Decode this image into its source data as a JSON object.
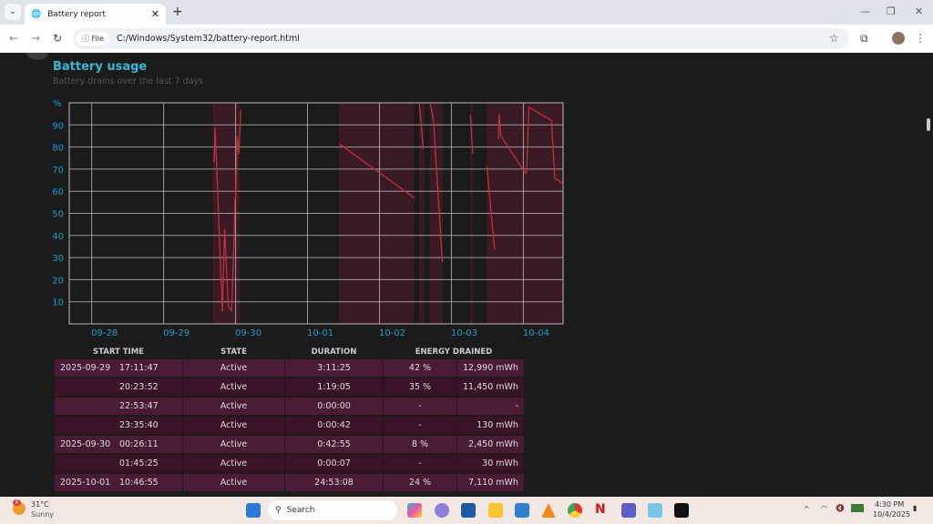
{
  "browser": {
    "tab_title": "Battery report",
    "file_chip": "File",
    "url": "C:/Windows/System32/battery-report.html"
  },
  "section": {
    "title": "Battery usage",
    "subtitle": "Battery drains over the last 7 days"
  },
  "chart_data": {
    "type": "line",
    "ylabel": "%",
    "ylim": [
      0,
      100
    ],
    "yticks": [
      10,
      20,
      30,
      40,
      50,
      60,
      70,
      80,
      90
    ],
    "xlim": [
      "2025-09-27T16:30",
      "2025-10-04T13:15"
    ],
    "xticks": [
      {
        "label": "09-28",
        "t": "2025-09-28T00:00"
      },
      {
        "label": "09-29",
        "t": "2025-09-29T00:00"
      },
      {
        "label": "09-30",
        "t": "2025-09-30T00:00"
      },
      {
        "label": "10-01",
        "t": "2025-10-01T00:00"
      },
      {
        "label": "10-02",
        "t": "2025-10-02T00:00"
      },
      {
        "label": "10-03",
        "t": "2025-10-03T00:00"
      },
      {
        "label": "10-04",
        "t": "2025-10-04T00:00"
      }
    ],
    "grid": true,
    "line_color": "#c0303e",
    "shade_color": "#3a1a24",
    "active_periods": [
      [
        "2025-09-29T16:19",
        "2025-09-30T01:26"
      ],
      [
        "2025-10-01T10:34",
        "2025-10-02T11:31"
      ],
      [
        "2025-10-02T13:12",
        "2025-10-02T14:53"
      ],
      [
        "2025-10-02T16:48",
        "2025-10-02T21:07"
      ],
      [
        "2025-10-03T06:14",
        "2025-10-03T07:12"
      ],
      [
        "2025-10-03T11:46",
        "2025-10-04T13:12"
      ]
    ],
    "series": [
      {
        "points": [
          [
            "2025-09-29T16:50",
            73
          ],
          [
            "2025-09-29T17:10",
            89
          ],
          [
            "2025-09-29T19:35",
            5.5
          ],
          [
            "2025-09-29T20:21",
            43
          ],
          [
            "2025-09-29T21:34",
            7.5
          ],
          [
            "2025-09-29T22:41",
            6
          ],
          [
            "2025-09-29T23:32",
            41
          ],
          [
            "2025-09-29T23:50",
            57
          ]
        ]
      },
      {
        "points": [
          [
            "2025-09-30T00:00",
            57
          ],
          [
            "2025-09-30T00:33",
            85
          ],
          [
            "2025-09-30T01:06",
            77
          ],
          [
            "2025-09-30T01:46",
            97
          ]
        ]
      },
      {
        "points": [
          [
            "2025-10-01T10:32",
            81.5
          ],
          [
            "2025-10-02T11:35",
            57
          ]
        ]
      },
      {
        "points": [
          [
            "2025-10-02T13:15",
            100
          ],
          [
            "2025-10-02T14:38",
            79
          ]
        ]
      },
      {
        "points": [
          [
            "2025-10-02T16:52",
            100
          ],
          [
            "2025-10-02T17:59",
            92.5
          ],
          [
            "2025-10-02T20:58",
            28
          ]
        ]
      },
      {
        "points": [
          [
            "2025-10-03T06:20",
            94.5
          ],
          [
            "2025-10-03T07:07",
            77
          ]
        ]
      },
      {
        "points": [
          [
            "2025-10-03T11:51",
            71
          ],
          [
            "2025-10-03T14:24",
            33.5
          ]
        ]
      },
      {
        "points": [
          [
            "2025-10-03T15:43",
            83.5
          ],
          [
            "2025-10-03T15:55",
            95
          ],
          [
            "2025-10-03T16:29",
            85
          ],
          [
            "2025-10-04T00:46",
            68
          ],
          [
            "2025-10-04T01:06",
            69
          ],
          [
            "2025-10-04T01:52",
            98
          ],
          [
            "2025-10-04T09:23",
            92
          ],
          [
            "2025-10-04T10:29",
            66
          ],
          [
            "2025-10-04T13:02",
            63.7
          ]
        ]
      }
    ]
  },
  "table": {
    "headers": [
      "START TIME",
      "STATE",
      "DURATION",
      "ENERGY DRAINED"
    ],
    "rows": [
      {
        "date": "2025-09-29",
        "time": "17:11:47",
        "state": "Active",
        "duration": "3:11:25",
        "pct": "42 %",
        "mwh": "12,990 mWh"
      },
      {
        "date": "",
        "time": "20:23:52",
        "state": "Active",
        "duration": "1:19:05",
        "pct": "35 %",
        "mwh": "11,450 mWh"
      },
      {
        "date": "",
        "time": "22:53:47",
        "state": "Active",
        "duration": "0:00:00",
        "pct": "-",
        "mwh": "-"
      },
      {
        "date": "",
        "time": "23:35:40",
        "state": "Active",
        "duration": "0:00:42",
        "pct": "-",
        "mwh": "130 mWh"
      },
      {
        "date": "2025-09-30",
        "time": "00:26:11",
        "state": "Active",
        "duration": "0:42:55",
        "pct": "8 %",
        "mwh": "2,450 mWh"
      },
      {
        "date": "",
        "time": "01:45:25",
        "state": "Active",
        "duration": "0:00:07",
        "pct": "-",
        "mwh": "30 mWh"
      },
      {
        "date": "2025-10-01",
        "time": "10:46:55",
        "state": "Active",
        "duration": "24:53:08",
        "pct": "24 %",
        "mwh": "7,110 mWh"
      }
    ]
  },
  "taskbar": {
    "weather_temp": "31°C",
    "weather_desc": "Sunny",
    "weather_badge": "6",
    "search": "Search",
    "time": "4:30 PM",
    "date": "10/4/2025"
  }
}
